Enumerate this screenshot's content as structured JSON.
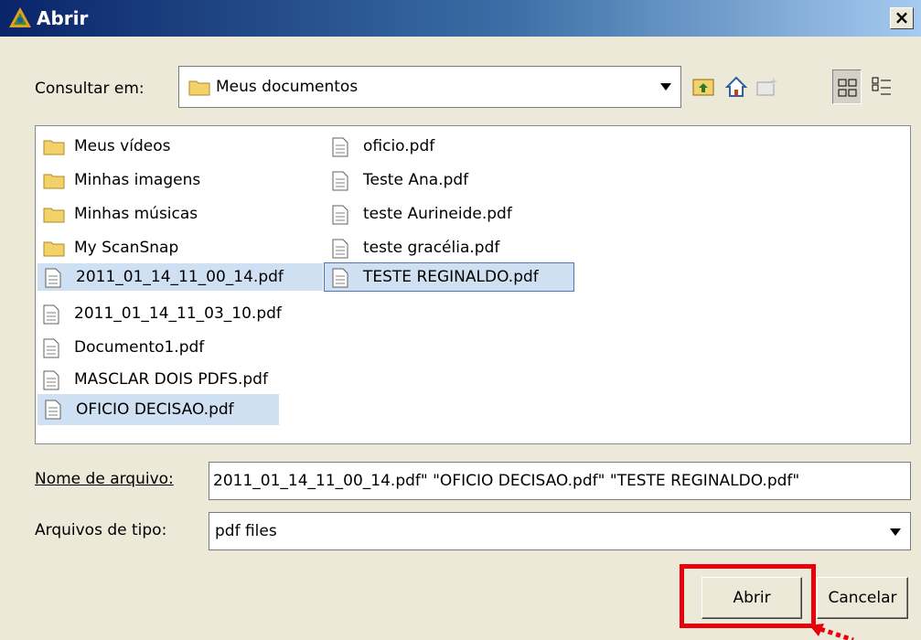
{
  "window": {
    "title": "Abrir",
    "close_symbol": "×"
  },
  "lookin": {
    "label": "Consultar em:",
    "value": "Meus documentos"
  },
  "files": [
    {
      "name": "Meus vídeos",
      "type": "folder",
      "selected": false
    },
    {
      "name": "Minhas imagens",
      "type": "folder",
      "selected": false
    },
    {
      "name": "Minhas músicas",
      "type": "folder",
      "selected": false
    },
    {
      "name": "My ScanSnap",
      "type": "folder",
      "selected": false
    },
    {
      "name": "2011_01_14_11_00_14.pdf",
      "type": "file",
      "selected": true
    },
    {
      "name": "2011_01_14_11_03_10.pdf",
      "type": "file",
      "selected": false
    },
    {
      "name": "Documento1.pdf",
      "type": "file",
      "selected": false
    },
    {
      "name": "MASCLAR DOIS PDFS.pdf",
      "type": "file",
      "selected": false
    },
    {
      "name": "OFICIO DECISAO.pdf",
      "type": "file",
      "selected": true
    },
    {
      "name": "oficio.pdf",
      "type": "file",
      "selected": false
    },
    {
      "name": "Teste Ana.pdf",
      "type": "file",
      "selected": false
    },
    {
      "name": "teste Aurineide.pdf",
      "type": "file",
      "selected": false
    },
    {
      "name": "teste gracélia.pdf",
      "type": "file",
      "selected": false
    },
    {
      "name": "TESTE REGINALDO.pdf",
      "type": "file",
      "selected": true
    }
  ],
  "filename": {
    "label": "Nome de arquivo:",
    "value": "2011_01_14_11_00_14.pdf\" \"OFICIO DECISAO.pdf\" \"TESTE REGINALDO.pdf\""
  },
  "filetype": {
    "label": "Arquivos de tipo:",
    "value": "pdf files"
  },
  "buttons": {
    "open": "Abrir",
    "cancel": "Cancelar"
  },
  "icons": {
    "app": "java-app-icon",
    "up_folder": "up-folder-icon",
    "home": "home-icon",
    "new_folder": "new-folder-icon",
    "list_view": "list-view-icon",
    "details_view": "details-view-icon"
  },
  "colors": {
    "titlebar": "#0a246a",
    "selection": "#cfe0f3",
    "highlight": "#e8000b"
  }
}
